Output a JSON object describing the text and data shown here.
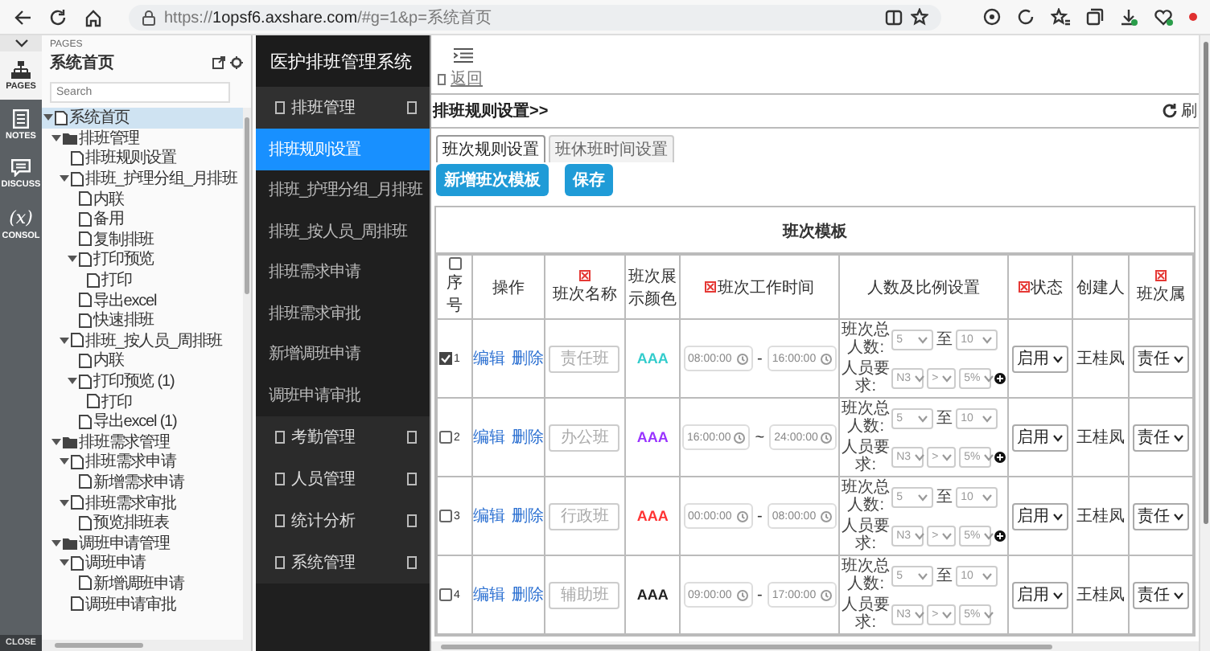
{
  "browser": {
    "url_scheme": "https://",
    "url_host": "1opsf6.axshare.com",
    "url_path": "/#g=1&p=系统首页"
  },
  "rail": {
    "items": [
      {
        "label": "PAGES",
        "kind": "pages",
        "selected": true
      },
      {
        "label": "NOTES",
        "kind": "notes",
        "selected": false
      },
      {
        "label": "DISCUSS",
        "kind": "discuss",
        "selected": false
      },
      {
        "label": "CONSOL",
        "kind": "console",
        "selected": false,
        "glyph": "(x)"
      }
    ],
    "close": "CLOSE"
  },
  "pages_panel": {
    "header": "PAGES",
    "title": "系统首页",
    "search": {
      "placeholder": "Search"
    },
    "tree": [
      {
        "label": "系统首页",
        "kind": "page",
        "selected": true,
        "expanded": true,
        "children": [
          {
            "label": "排班管理",
            "kind": "folder",
            "selected": false,
            "expanded": true,
            "children": [
              {
                "label": "排班规则设置",
                "kind": "page",
                "selected": false
              },
              {
                "label": "排班_护理分组_月排班",
                "kind": "page",
                "selected": false,
                "expanded": true,
                "children": [
                  {
                    "label": "内联",
                    "kind": "page",
                    "selected": false
                  },
                  {
                    "label": "备用",
                    "kind": "page",
                    "selected": false
                  },
                  {
                    "label": "复制排班",
                    "kind": "page",
                    "selected": false
                  },
                  {
                    "label": "打印预览",
                    "kind": "page",
                    "selected": false,
                    "expanded": true,
                    "children": [
                      {
                        "label": "打印",
                        "kind": "page",
                        "selected": false
                      }
                    ]
                  },
                  {
                    "label": "导出excel",
                    "kind": "page",
                    "selected": false
                  },
                  {
                    "label": "快速排班",
                    "kind": "page",
                    "selected": false
                  }
                ]
              },
              {
                "label": "排班_按人员_周排班",
                "kind": "page",
                "selected": false,
                "expanded": true,
                "children": [
                  {
                    "label": "内联",
                    "kind": "page",
                    "selected": false
                  },
                  {
                    "label": "打印预览 (1)",
                    "kind": "page",
                    "selected": false,
                    "expanded": true,
                    "children": [
                      {
                        "label": "打印",
                        "kind": "page",
                        "selected": false
                      }
                    ]
                  },
                  {
                    "label": "导出excel (1)",
                    "kind": "page",
                    "selected": false
                  }
                ]
              }
            ]
          },
          {
            "label": "排班需求管理",
            "kind": "folder",
            "selected": false,
            "expanded": true,
            "children": [
              {
                "label": "排班需求申请",
                "kind": "page",
                "selected": false,
                "expanded": true,
                "children": [
                  {
                    "label": "新增需求申请",
                    "kind": "page",
                    "selected": false
                  }
                ]
              },
              {
                "label": "排班需求审批",
                "kind": "page",
                "selected": false,
                "expanded": true,
                "children": [
                  {
                    "label": "预览排班表",
                    "kind": "page",
                    "selected": false
                  }
                ]
              }
            ]
          },
          {
            "label": "调班申请管理",
            "kind": "folder",
            "selected": false,
            "expanded": true,
            "children": [
              {
                "label": "调班申请",
                "kind": "page",
                "selected": false,
                "expanded": true,
                "children": [
                  {
                    "label": "新增调班申请",
                    "kind": "page",
                    "selected": false
                  }
                ]
              },
              {
                "label": "调班申请审批",
                "kind": "page",
                "selected": false
              }
            ]
          }
        ]
      }
    ]
  },
  "sidebar": {
    "title": "医护排班管理系统",
    "groups": [
      {
        "label": "排班管理",
        "expanded": true,
        "items": [
          {
            "label": "排班规则设置",
            "selected": true
          },
          {
            "label": "排班_护理分组_月排班",
            "selected": false
          },
          {
            "label": "排班_按人员_周排班",
            "selected": false
          },
          {
            "label": "排班需求申请",
            "selected": false
          },
          {
            "label": "排班需求审批",
            "selected": false
          },
          {
            "label": "新增调班申请",
            "selected": false
          },
          {
            "label": "调班申请审批",
            "selected": false
          }
        ]
      },
      {
        "label": "考勤管理",
        "expanded": false
      },
      {
        "label": "人员管理",
        "expanded": false
      },
      {
        "label": "统计分析",
        "expanded": false
      },
      {
        "label": "系统管理",
        "expanded": false
      }
    ]
  },
  "main": {
    "back": "返回",
    "breadcrumb": "排班规则设置>>",
    "refresh": "刷",
    "tabs": [
      {
        "label": "班次规则设置",
        "selected": true
      },
      {
        "label": "班休班时间设置",
        "selected": false
      }
    ],
    "buttons": [
      "新增班次模板",
      "保存"
    ],
    "panel_title": "班次模板",
    "table": {
      "select_all": {
        "checked": false
      },
      "columns": [
        {
          "label": "序号",
          "required": false
        },
        {
          "label": "操作",
          "required": false
        },
        {
          "label": "班次名称",
          "required": true
        },
        {
          "label": "班次展示颜色",
          "required": false
        },
        {
          "label": "班次工作时间",
          "required": true
        },
        {
          "label": "人数及比例设置",
          "required": false
        },
        {
          "label": "状态",
          "required": true
        },
        {
          "label": "创建人",
          "required": false
        },
        {
          "label": "班次属",
          "required": true
        }
      ],
      "rows": [
        {
          "checked": true,
          "index": "1",
          "actions": [
            "编辑",
            "删除"
          ],
          "name_field": {
            "placeholder": "责任班"
          },
          "color": "#33cccc",
          "color_text": "AAA",
          "start": "08:00:00",
          "separator": "-",
          "end": "16:00:00",
          "total_label": "班次总人数:",
          "total_min": "5",
          "to": "至",
          "total_max": "10",
          "req_label": "人员要求:",
          "grade": "N3",
          "op": ">",
          "ratio": "5%",
          "can_add": true,
          "status": "启用",
          "creator": "王桂凤",
          "attribute": "责任"
        },
        {
          "checked": false,
          "index": "2",
          "actions": [
            "编辑",
            "删除"
          ],
          "name_field": {
            "placeholder": "办公班"
          },
          "color": "#9933ff",
          "color_text": "AAA",
          "start": "16:00:00",
          "separator": "~",
          "end": "24:00:00",
          "total_label": "班次总人数:",
          "total_min": "5",
          "to": "至",
          "total_max": "10",
          "req_label": "人员要求:",
          "grade": "N3",
          "op": ">",
          "ratio": "5%",
          "can_add": true,
          "status": "启用",
          "creator": "王桂凤",
          "attribute": "责任"
        },
        {
          "checked": false,
          "index": "3",
          "actions": [
            "编辑",
            "删除"
          ],
          "name_field": {
            "placeholder": "行政班"
          },
          "color": "#ff3333",
          "color_text": "AAA",
          "start": "00:00:00",
          "separator": "-",
          "end": "08:00:00",
          "total_label": "班次总人数:",
          "total_min": "5",
          "to": "至",
          "total_max": "10",
          "req_label": "人员要求:",
          "grade": "N3",
          "op": ">",
          "ratio": "5%",
          "can_add": true,
          "status": "启用",
          "creator": "王桂凤",
          "attribute": "责任"
        },
        {
          "checked": false,
          "index": "4",
          "actions": [
            "编辑",
            "删除"
          ],
          "name_field": {
            "placeholder": "辅助班"
          },
          "color": "#222222",
          "color_text": "AAA",
          "start": "09:00:00",
          "separator": "-",
          "end": "17:00:00",
          "total_label": "班次总人数:",
          "total_min": "5",
          "to": "至",
          "total_max": "10",
          "req_label": "人员要求:",
          "grade": "N3",
          "op": ">",
          "ratio": "5%",
          "can_add": false,
          "status": "启用",
          "creator": "王桂凤",
          "attribute": "责任"
        }
      ]
    }
  }
}
